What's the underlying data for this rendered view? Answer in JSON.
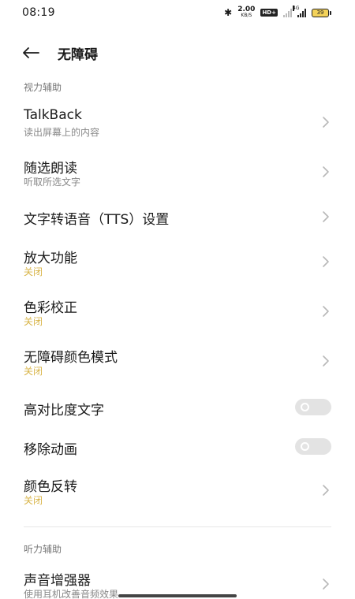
{
  "status_bar": {
    "time": "08:19",
    "speed_value": "2.00",
    "speed_unit": "KB/S",
    "hd_label": "HD+",
    "network_label": "4G",
    "battery_level": "39"
  },
  "header": {
    "title": "无障碍"
  },
  "sections": {
    "vision": "视力辅助",
    "hearing": "听力辅助"
  },
  "items": {
    "talkback": {
      "title": "TalkBack",
      "subtitle": "读出屏幕上的内容"
    },
    "select_to_speak": {
      "title": "随选朗读",
      "subtitle": "听取所选文字"
    },
    "tts": {
      "title": "文字转语音（TTS）设置"
    },
    "magnification": {
      "title": "放大功能",
      "status": "关闭"
    },
    "color_correction": {
      "title": "色彩校正",
      "status": "关闭"
    },
    "color_mode": {
      "title": "无障碍颜色模式",
      "status": "关闭"
    },
    "high_contrast": {
      "title": "高对比度文字",
      "enabled": false
    },
    "remove_animations": {
      "title": "移除动画",
      "enabled": false
    },
    "color_inversion": {
      "title": "颜色反转",
      "status": "关闭"
    },
    "sound_amplifier": {
      "title": "声音增强器",
      "subtitle": "使用耳机改善音频效果"
    }
  },
  "colors": {
    "status_off": "#d8b447",
    "toggle_track": "#e3e3e3"
  }
}
